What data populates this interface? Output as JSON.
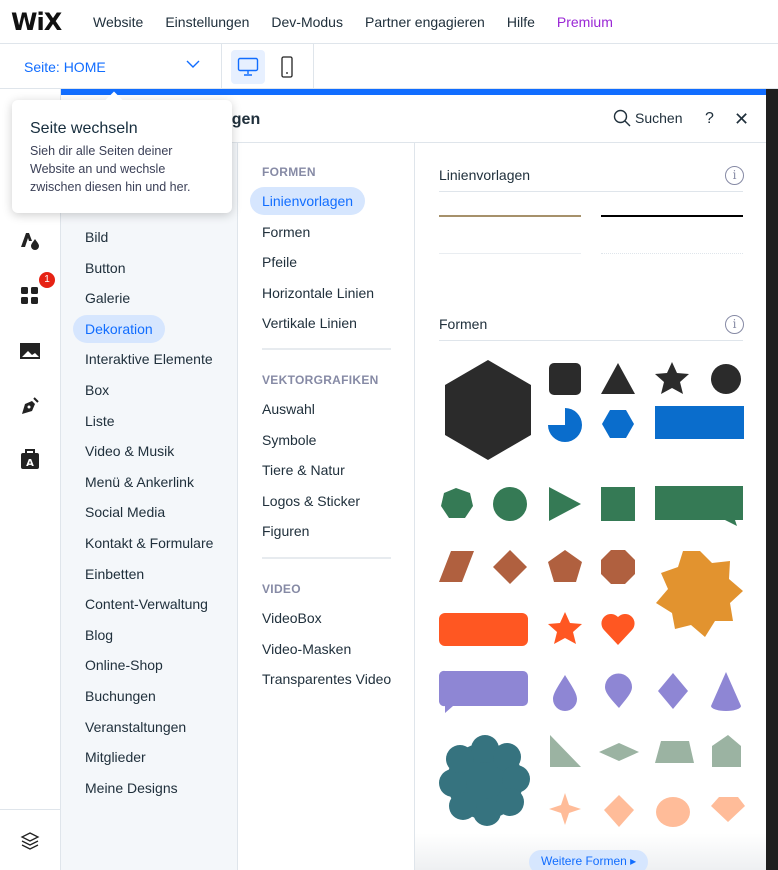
{
  "topbar": {
    "logo": "WiX",
    "menu": [
      "Website",
      "Einstellungen",
      "Dev-Modus",
      "Partner engagieren",
      "Hilfe",
      "Premium"
    ]
  },
  "page_selector": {
    "label": "Seite: HOME"
  },
  "tooltip": {
    "title": "Seite wechseln",
    "body": "Sieh dir alle Seiten deiner Website an und wechsle zwischen diesen hin und her."
  },
  "left_toolbar": {
    "apps_badge": "1"
  },
  "panel": {
    "title": "Hinzufügen",
    "title_visible": "ügen",
    "search_label": "Suchen",
    "help": "?",
    "close": "✕",
    "categories": [
      "Bild",
      "Button",
      "Galerie",
      "Dekoration",
      "Interaktive Elemente",
      "Box",
      "Liste",
      "Video & Musik",
      "Menü & Ankerlink",
      "Social Media",
      "Kontakt & Formulare",
      "Einbetten",
      "Content-Verwaltung",
      "Blog",
      "Online-Shop",
      "Buchungen",
      "Veranstaltungen",
      "Mitglieder",
      "Meine Designs"
    ],
    "selected_category": "Dekoration",
    "subsections": [
      {
        "heading": "FORMEN",
        "items": [
          "Linienvorlagen",
          "Formen",
          "Pfeile",
          "Horizontale Linien",
          "Vertikale Linien"
        ]
      },
      {
        "heading": "VEKTORGRAFIKEN",
        "items": [
          "Auswahl",
          "Symbole",
          "Tiere & Natur",
          "Logos & Sticker",
          "Figuren"
        ]
      },
      {
        "heading": "VIDEO",
        "items": [
          "VideoBox",
          "Video-Masken",
          "Transparentes Video"
        ]
      }
    ],
    "selected_subitem": "Linienvorlagen",
    "line_section": {
      "title": "Linienvorlagen",
      "info": "i",
      "line_colors": [
        "#a6916b",
        "#000000",
        "#e9edf1",
        "#e9edf1"
      ]
    },
    "shapes_section": {
      "title": "Formen",
      "info": "i",
      "more_button": "Weitere Formen ▸"
    },
    "accent": "#116dff"
  }
}
